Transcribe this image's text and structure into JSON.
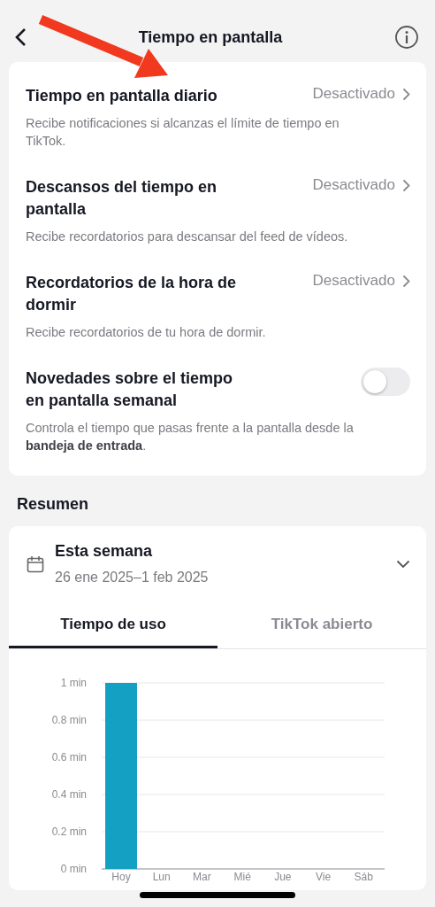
{
  "header": {
    "title": "Tiempo en pantalla"
  },
  "settings": [
    {
      "kind": "link",
      "title": "Tiempo en pantalla diario",
      "status": "Desactivado",
      "description": "Recibe notificaciones si alcanzas el límite de tiempo en TikTok."
    },
    {
      "kind": "link",
      "title": "Descansos del tiempo en pantalla",
      "status": "Desactivado",
      "description": "Recibe recordatorios para descansar del feed de vídeos."
    },
    {
      "kind": "link",
      "title": "Recordatorios de la hora de dormir",
      "status": "Desactivado",
      "description": "Recibe recordatorios de tu hora de dormir."
    },
    {
      "kind": "toggle",
      "title": "Novedades sobre el tiempo en pantalla semanal",
      "on": false,
      "description": "Controla el tiempo que pasas frente a la pantalla desde la **bandeja de entrada**."
    }
  ],
  "summary": {
    "heading": "Resumen",
    "period": "Esta semana",
    "range": "26 ene 2025–1 feb 2025",
    "tabs": [
      {
        "label": "Tiempo de uso",
        "selected": true
      },
      {
        "label": "TikTok abierto",
        "selected": false
      }
    ],
    "chart_data": {
      "type": "bar",
      "categories": [
        "Hoy",
        "Lun",
        "Mar",
        "Mié",
        "Jue",
        "Vie",
        "Sáb"
      ],
      "series": [
        {
          "color": "#13a0c2",
          "values": [
            1,
            0,
            0,
            0,
            0,
            0,
            0
          ]
        }
      ],
      "grid": true,
      "ylim": [
        0,
        1
      ],
      "yticks": [
        {
          "value": 0,
          "label": "0 min"
        },
        {
          "value": 0.2,
          "label": "0.2 min"
        },
        {
          "value": 0.4,
          "label": "0.4 min"
        },
        {
          "value": 0.6,
          "label": "0.6 min"
        },
        {
          "value": 0.8,
          "label": "0.8 min"
        },
        {
          "value": 1,
          "label": "1 min"
        }
      ]
    }
  }
}
